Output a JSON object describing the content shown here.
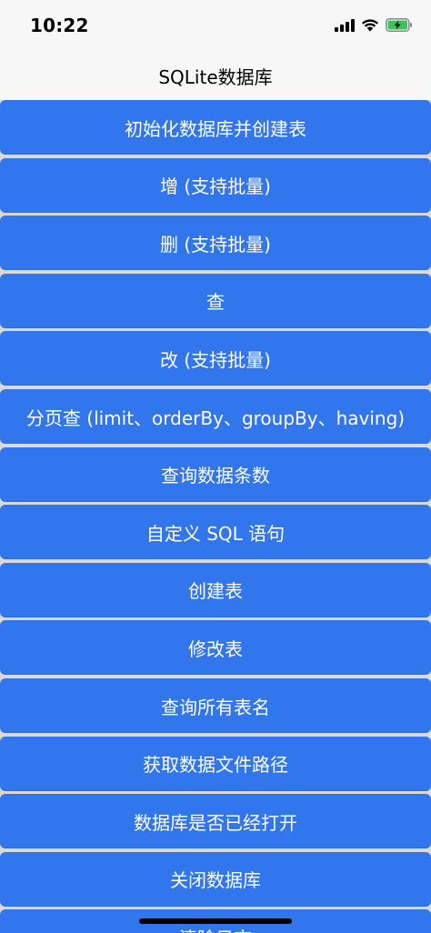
{
  "status_bar": {
    "time": "10:22",
    "icons": [
      "signal-icon",
      "wifi-icon",
      "battery-charging-icon"
    ],
    "battery_color": "#34c759"
  },
  "nav": {
    "title": "SQLite数据库"
  },
  "buttons": [
    "初始化数据库并创建表",
    "增 (支持批量)",
    "删 (支持批量)",
    "查",
    "改 (支持批量)",
    "分页查 (limit、orderBy、groupBy、having)",
    "查询数据条数",
    "自定义 SQL 语句",
    "创建表",
    "修改表",
    "查询所有表名",
    "获取数据文件路径",
    "数据库是否已经打开",
    "关闭数据库",
    "清除日志"
  ],
  "colors": {
    "button_bg": "#3176ec",
    "button_text": "#ffffff",
    "bar_bg": "#f7f7f7"
  }
}
